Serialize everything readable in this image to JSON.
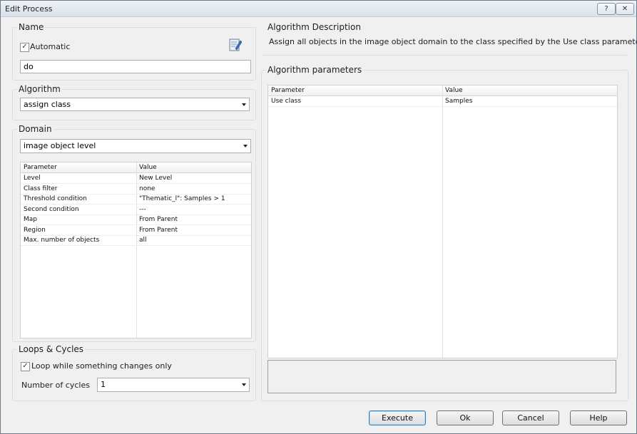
{
  "window": {
    "title": "Edit Process",
    "help_label": "?",
    "close_label": "✕"
  },
  "name_group": {
    "title": "Name",
    "automatic_label": "Automatic",
    "automatic_checked": true,
    "name_value": "do",
    "icon": "edit-document-icon"
  },
  "algorithm_group": {
    "title": "Algorithm",
    "selected": "assign class"
  },
  "domain_group": {
    "title": "Domain",
    "selected": "image object level",
    "columns": [
      "Parameter",
      "Value"
    ],
    "rows": [
      {
        "param": "Level",
        "value": "New Level"
      },
      {
        "param": "Class filter",
        "value": "none"
      },
      {
        "param": "Threshold condition",
        "value": "\"Thematic_l\": Samples > 1"
      },
      {
        "param": "Second condition",
        "value": "---"
      },
      {
        "param": "Map",
        "value": "From Parent"
      },
      {
        "param": "Region",
        "value": "From Parent"
      },
      {
        "param": "Max. number of objects",
        "value": "all"
      }
    ]
  },
  "loops_group": {
    "title": "Loops & Cycles",
    "loop_label": "Loop while something changes only",
    "loop_checked": true,
    "cycles_label": "Number of cycles",
    "cycles_value": "1"
  },
  "description_group": {
    "title": "Algorithm Description",
    "text": "Assign all objects in the image object domain to the class specified by the Use class parameter."
  },
  "parameters_group": {
    "title": "Algorithm parameters",
    "columns": [
      "Parameter",
      "Value"
    ],
    "rows": [
      {
        "param": "Use class",
        "value": "Samples"
      }
    ]
  },
  "buttons": {
    "execute": "Execute",
    "ok": "Ok",
    "cancel": "Cancel",
    "help": "Help"
  }
}
